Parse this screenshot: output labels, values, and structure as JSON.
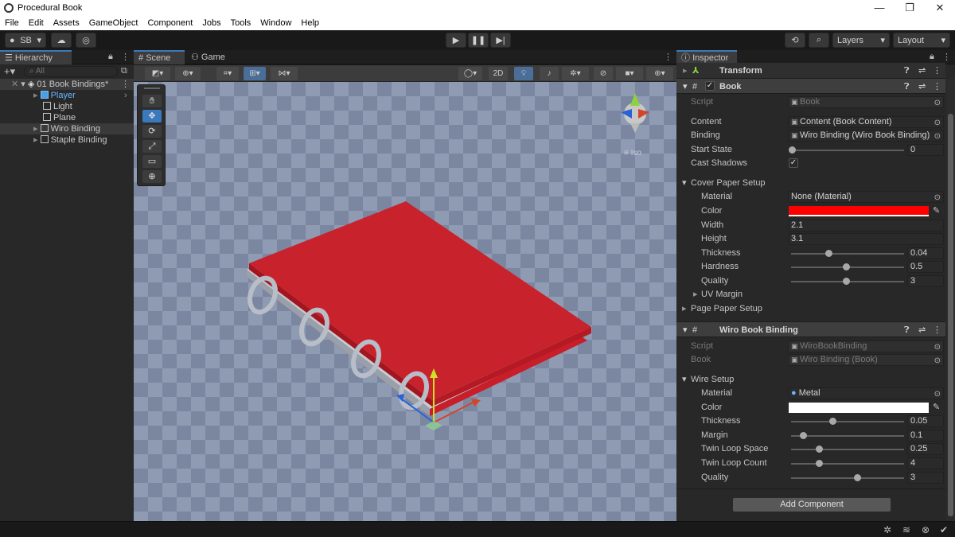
{
  "window": {
    "title": "Procedural Book",
    "minimize": "—",
    "maximize": "❐",
    "close": "✕"
  },
  "menu": [
    "File",
    "Edit",
    "Assets",
    "GameObject",
    "Component",
    "Jobs",
    "Tools",
    "Window",
    "Help"
  ],
  "toolbar": {
    "account": "SB",
    "layers": "Layers",
    "layout": "Layout"
  },
  "hierarchy": {
    "tab": "Hierarchy",
    "search_placeholder": "All",
    "items": [
      {
        "label": "01 Book Bindings*"
      },
      {
        "label": "Player"
      },
      {
        "label": "Light"
      },
      {
        "label": "Plane"
      },
      {
        "label": "Wiro Binding"
      },
      {
        "label": "Staple Binding"
      }
    ]
  },
  "scene": {
    "tab_scene": "Scene",
    "tab_game": "Game",
    "mode_2d": "2D",
    "gizmo_label": "≡ Iso"
  },
  "inspector": {
    "tab": "Inspector",
    "transform": {
      "title": "Transform"
    },
    "book": {
      "title": "Book",
      "script_label": "Script",
      "script_value": "Book",
      "content_label": "Content",
      "content_value": "Content (Book Content)",
      "binding_label": "Binding",
      "binding_value": "Wiro Binding (Wiro Book Binding)",
      "start_state_label": "Start State",
      "start_state_value": "0",
      "cast_shadows_label": "Cast Shadows",
      "cover_section": "Cover Paper Setup",
      "cover": {
        "material_label": "Material",
        "material_value": "None (Material)",
        "color_label": "Color",
        "color_value": "#ff0000",
        "width_label": "Width",
        "width_value": "2.1",
        "height_label": "Height",
        "height_value": "3.1",
        "thickness_label": "Thickness",
        "thickness_value": "0.04",
        "hardness_label": "Hardness",
        "hardness_value": "0.5",
        "quality_label": "Quality",
        "quality_value": "3",
        "uv_margin_label": "UV Margin"
      },
      "page_section": "Page Paper Setup"
    },
    "wiro": {
      "title": "Wiro Book Binding",
      "script_label": "Script",
      "script_value": "WiroBookBinding",
      "book_label": "Book",
      "book_value": "Wiro Binding (Book)",
      "wire_section": "Wire Setup",
      "material_label": "Material",
      "material_value": "Metal",
      "color_label": "Color",
      "color_value": "#ffffff",
      "thickness_label": "Thickness",
      "thickness_value": "0.05",
      "margin_label": "Margin",
      "margin_value": "0.1",
      "twin_space_label": "Twin Loop Space",
      "twin_space_value": "0.25",
      "twin_count_label": "Twin Loop Count",
      "twin_count_value": "4",
      "quality_label": "Quality",
      "quality_value": "3"
    },
    "add_component": "Add Component"
  }
}
